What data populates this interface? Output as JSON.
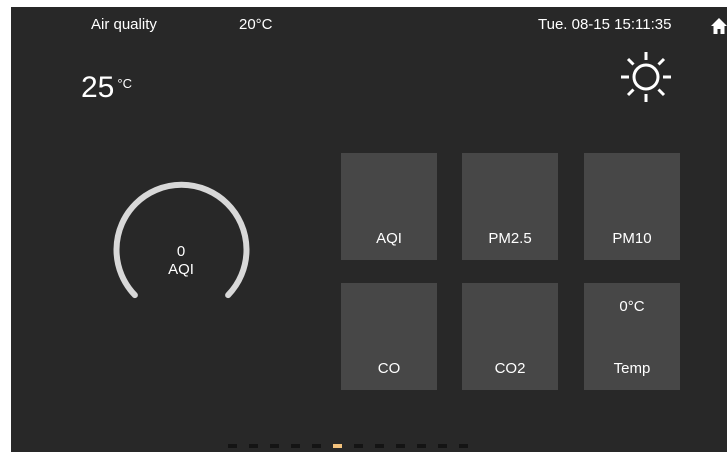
{
  "header": {
    "title": "Air quality",
    "outdoor_temp": "20°C",
    "datetime": "Tue. 08-15 15:11:35"
  },
  "room": {
    "temperature": "25",
    "unit": "°C"
  },
  "gauge": {
    "value": "0",
    "label": "AQI",
    "level_fraction": 0
  },
  "tiles": [
    {
      "label": "AQI",
      "value": ""
    },
    {
      "label": "PM2.5",
      "value": ""
    },
    {
      "label": "PM10",
      "value": ""
    },
    {
      "label": "CO",
      "value": ""
    },
    {
      "label": "CO2",
      "value": ""
    },
    {
      "label": "Temp",
      "value": "0°C"
    }
  ],
  "pager": {
    "count": 12,
    "active_index": 5
  },
  "colors": {
    "background": "#282828",
    "tile": "#474747",
    "gauge_arc": "#d8d8d8",
    "pager_active": "#f3c27d",
    "pager_inactive": "#141414"
  },
  "icons": {
    "weather": "sun-icon",
    "home": "home-icon"
  }
}
